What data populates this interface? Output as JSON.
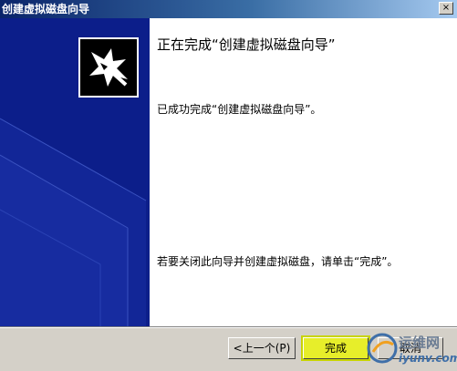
{
  "window": {
    "title": "创建虚拟磁盘向导",
    "close_glyph": "×"
  },
  "content": {
    "heading": "正在完成“创建虚拟磁盘向导”",
    "message_done": "已成功完成“创建虚拟磁盘向导”。",
    "message_close": "若要关闭此向导并创建虚拟磁盘，请单击“完成”。"
  },
  "buttons": {
    "back_label": "<上一个(P)",
    "finish_label": "完成",
    "cancel_label": "取消"
  },
  "watermark": {
    "chinese": "运维网",
    "english": "iyunv.com"
  },
  "colors": {
    "banner": "#0c1e8a",
    "highlight": "#e7ee2a"
  },
  "icons": {
    "wizard": "wizard-magic-icon"
  }
}
